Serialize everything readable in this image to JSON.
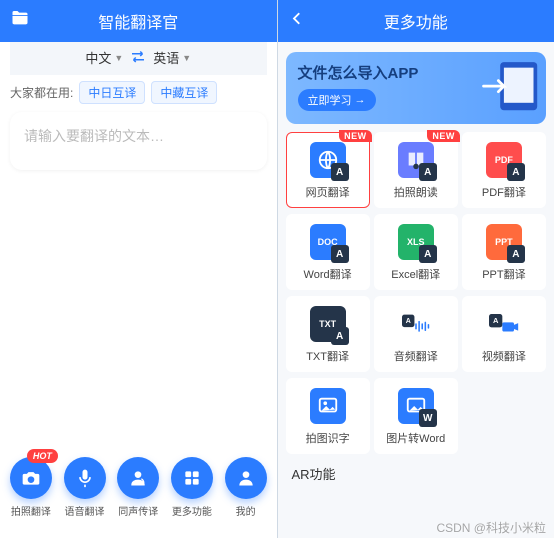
{
  "left": {
    "title": "智能翻译官",
    "lang_from": "中文",
    "lang_to": "英语",
    "tags_label": "大家都在用:",
    "tags": [
      "中日互译",
      "中藏互译"
    ],
    "placeholder": "请输入要翻译的文本…",
    "nav": [
      {
        "id": "camera",
        "label": "拍照翻译",
        "hot": "HOT"
      },
      {
        "id": "voice",
        "label": "语音翻译"
      },
      {
        "id": "simul",
        "label": "同声传译"
      },
      {
        "id": "more",
        "label": "更多功能"
      },
      {
        "id": "me",
        "label": "我的"
      }
    ]
  },
  "right": {
    "title": "更多功能",
    "promo": {
      "title": "文件怎么导入APP",
      "cta": "立即学习",
      "arrow": "→"
    },
    "grid": [
      {
        "id": "web",
        "label": "网页翻译",
        "kind": "globe",
        "color": "#2b7cff",
        "new": true,
        "selected": true
      },
      {
        "id": "ocr",
        "label": "拍照朗读",
        "kind": "book",
        "color": "#6a7dff",
        "new": true
      },
      {
        "id": "pdf",
        "label": "PDF翻译",
        "kind": "pdf",
        "color": "#ff4d4d"
      },
      {
        "id": "word",
        "label": "Word翻译",
        "kind": "doc",
        "color": "#2b7cff"
      },
      {
        "id": "excel",
        "label": "Excel翻译",
        "kind": "xls",
        "color": "#23b36a"
      },
      {
        "id": "ppt",
        "label": "PPT翻译",
        "kind": "ppt",
        "color": "#ff6a3c"
      },
      {
        "id": "txt",
        "label": "TXT翻译",
        "kind": "txt",
        "color": "#243449"
      },
      {
        "id": "audio",
        "label": "音频翻译",
        "kind": "audio",
        "color": "#243449"
      },
      {
        "id": "video",
        "label": "视频翻译",
        "kind": "video",
        "color": "#243449"
      },
      {
        "id": "ocrtxt",
        "label": "拍图识字",
        "kind": "img",
        "color": "#2b7cff"
      },
      {
        "id": "img2w",
        "label": "图片转Word",
        "kind": "imgw",
        "color": "#2b7cff"
      }
    ],
    "section_ar": "AR功能"
  },
  "watermark": "CSDN @科技小米粒",
  "badges": {
    "new": "NEW"
  },
  "doc_tags": {
    "doc": "DOC",
    "xls": "XLS",
    "ppt": "PPT",
    "pdf": "PDF",
    "txt": "TXT"
  }
}
